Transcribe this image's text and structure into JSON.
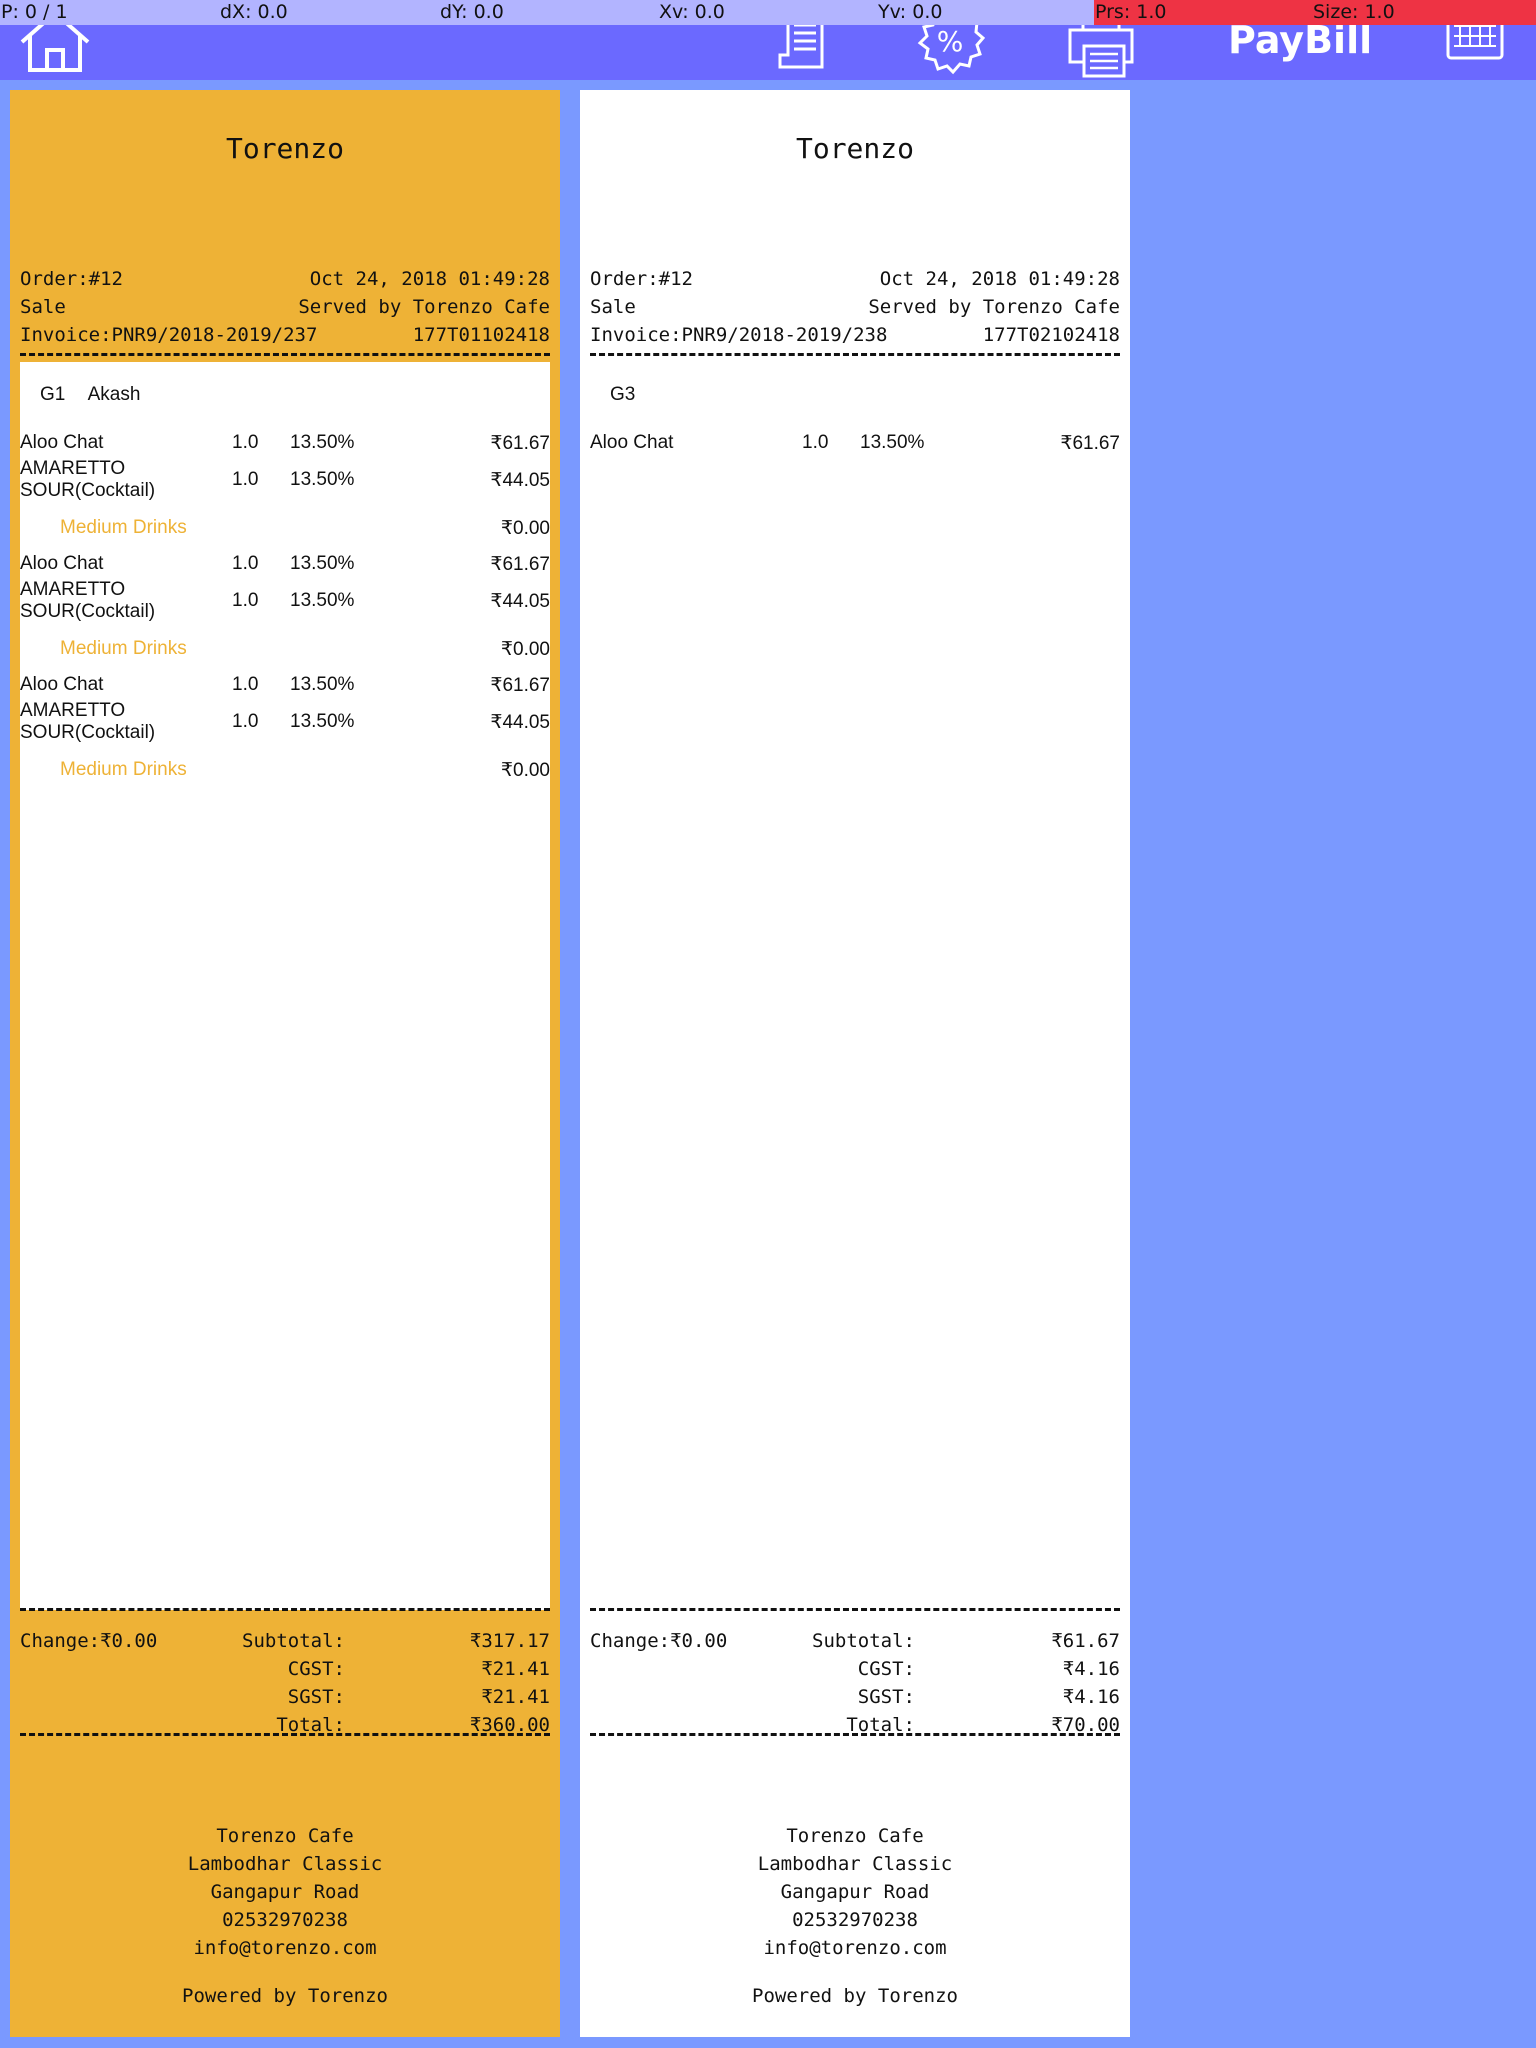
{
  "debug": {
    "p": "P: 0 / 1",
    "dx": "dX: 0.0",
    "dy": "dY: 0.0",
    "xv": "Xv: 0.0",
    "yv": "Yv: 0.0",
    "prs": "Prs: 1.0",
    "size": "Size: 1.0"
  },
  "toolbar": {
    "title": "PayBill",
    "icons": [
      "home-icon",
      "receipt-icon",
      "discount-icon",
      "printer-icon",
      "keyboard-icon"
    ]
  },
  "colors": {
    "background": "#7a99ff",
    "toolbar": "#6b69ff",
    "selected_receipt": "#eeb236",
    "accent_text": "#eeb236"
  },
  "receipts": [
    {
      "title": "Torenzo",
      "order": "Order:#12",
      "datetime": "Oct 24, 2018 01:49:28",
      "type": "Sale",
      "served_by": "Served by Torenzo Cafe",
      "invoice": "Invoice:PNR9/2018-2019/237",
      "code": "177T01102418",
      "table": "G1",
      "customer": "Akash",
      "items": [
        {
          "name": "Aloo Chat",
          "qty": "1.0",
          "tax": "13.50%",
          "price": "₹61.67"
        },
        {
          "name": "AMARETTO SOUR(Cocktail)",
          "qty": "1.0",
          "tax": "13.50%",
          "price": "₹44.05"
        },
        {
          "name": "Medium Drinks",
          "qty": "",
          "tax": "",
          "price": "₹0.00",
          "modifier": true
        },
        {
          "name": "Aloo Chat",
          "qty": "1.0",
          "tax": "13.50%",
          "price": "₹61.67"
        },
        {
          "name": "AMARETTO SOUR(Cocktail)",
          "qty": "1.0",
          "tax": "13.50%",
          "price": "₹44.05"
        },
        {
          "name": "Medium Drinks",
          "qty": "",
          "tax": "",
          "price": "₹0.00",
          "modifier": true
        },
        {
          "name": "Aloo Chat",
          "qty": "1.0",
          "tax": "13.50%",
          "price": "₹61.67"
        },
        {
          "name": "AMARETTO SOUR(Cocktail)",
          "qty": "1.0",
          "tax": "13.50%",
          "price": "₹44.05"
        },
        {
          "name": "Medium Drinks",
          "qty": "",
          "tax": "",
          "price": "₹0.00",
          "modifier": true
        }
      ],
      "change": "Change:₹0.00",
      "subtotal_label": "Subtotal:",
      "subtotal": "₹317.17",
      "cgst_label": "CGST:",
      "cgst": "₹21.41",
      "sgst_label": "SGST:",
      "sgst": "₹21.41",
      "total_label": "Total:",
      "total": "₹360.00",
      "footer": [
        "Torenzo Cafe",
        "Lambodhar Classic",
        "Gangapur Road",
        "02532970238",
        "info@torenzo.com"
      ],
      "powered": "Powered by Torenzo"
    },
    {
      "title": "Torenzo",
      "order": "Order:#12",
      "datetime": "Oct 24, 2018 01:49:28",
      "type": "Sale",
      "served_by": "Served by Torenzo Cafe",
      "invoice": "Invoice:PNR9/2018-2019/238",
      "code": "177T02102418",
      "table": "G3",
      "customer": "",
      "items": [
        {
          "name": "Aloo Chat",
          "qty": "1.0",
          "tax": "13.50%",
          "price": "₹61.67"
        }
      ],
      "change": "Change:₹0.00",
      "subtotal_label": "Subtotal:",
      "subtotal": "₹61.67",
      "cgst_label": "CGST:",
      "cgst": "₹4.16",
      "sgst_label": "SGST:",
      "sgst": "₹4.16",
      "total_label": "Total:",
      "total": "₹70.00",
      "footer": [
        "Torenzo Cafe",
        "Lambodhar Classic",
        "Gangapur Road",
        "02532970238",
        "info@torenzo.com"
      ],
      "powered": "Powered by Torenzo"
    }
  ]
}
